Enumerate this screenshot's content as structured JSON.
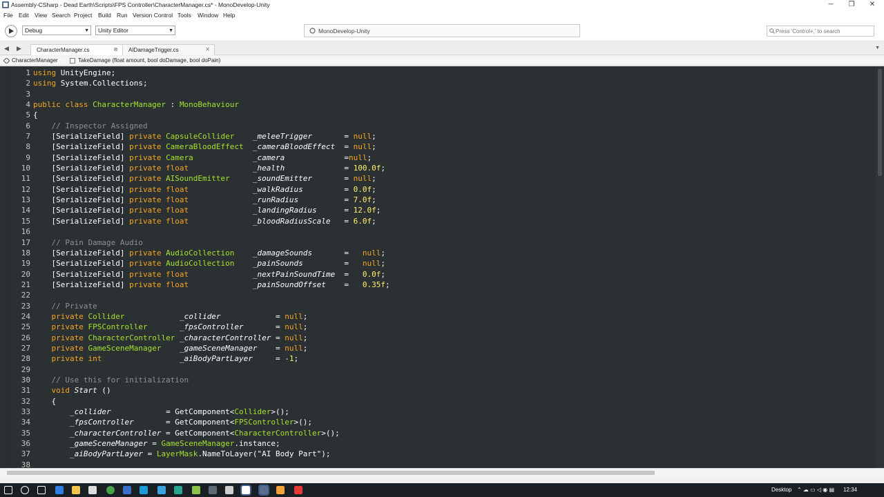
{
  "window": {
    "title": "Assembly-CSharp - Dead Earth\\Scripts\\FPS Controller\\CharacterManager.cs* - MonoDevelop-Unity",
    "minimize": "─",
    "maximize": "❐",
    "close": "✕"
  },
  "menu": [
    "File",
    "Edit",
    "View",
    "Search",
    "Project",
    "Build",
    "Run",
    "Version Control",
    "Tools",
    "Window",
    "Help"
  ],
  "toolbar": {
    "configuration": "Debug",
    "target": "Unity Editor",
    "status": "MonoDevelop-Unity",
    "search_placeholder": "Press 'Control+,' to search"
  },
  "tabs": [
    {
      "label": "CharacterManager.cs",
      "close": "⊗"
    },
    {
      "label": "AIDamageTrigger.cs",
      "close": "✕"
    }
  ],
  "path": {
    "class": "CharacterManager",
    "member": "TakeDamage (float amount, bool doDamage, bool doPain)"
  },
  "colors": {
    "editor_background": "#2b3032",
    "keyword": "#f6a623",
    "type": "#a6e22e",
    "identifier": "#ffffff",
    "comment": "#8a9299",
    "number": "#fff36b",
    "string": "#ffffff"
  },
  "code_lines": [
    {
      "n": "1",
      "tokens": [
        [
          "k",
          "using"
        ],
        [
          "p",
          " UnityEngine;"
        ]
      ]
    },
    {
      "n": "2",
      "tokens": [
        [
          "k",
          "using"
        ],
        [
          "p",
          " System.Collections;"
        ]
      ]
    },
    {
      "n": "3",
      "tokens": []
    },
    {
      "n": "4",
      "tokens": [
        [
          "k",
          "public class "
        ],
        [
          "t",
          "CharacterManager"
        ],
        [
          "p",
          " : "
        ],
        [
          "t",
          "MonoBehaviour"
        ]
      ]
    },
    {
      "n": "5",
      "tokens": [
        [
          "p",
          "{"
        ]
      ]
    },
    {
      "n": "6",
      "tokens": [
        [
          "c",
          "    // Inspector Assigned"
        ]
      ]
    },
    {
      "n": "7",
      "tokens": [
        [
          "p",
          "    [SerializeField] "
        ],
        [
          "k",
          "private "
        ],
        [
          "t",
          "CapsuleCollider"
        ],
        [
          "p",
          "    "
        ],
        [
          "i",
          "_meleeTrigger"
        ],
        [
          "p",
          "       = "
        ],
        [
          "k",
          "null"
        ],
        [
          "p",
          ";"
        ]
      ]
    },
    {
      "n": "8",
      "tokens": [
        [
          "p",
          "    [SerializeField] "
        ],
        [
          "k",
          "private "
        ],
        [
          "t",
          "CameraBloodEffect"
        ],
        [
          "p",
          "  "
        ],
        [
          "i",
          "_cameraBloodEffect"
        ],
        [
          "p",
          "  = "
        ],
        [
          "k",
          "null"
        ],
        [
          "p",
          ";"
        ]
      ]
    },
    {
      "n": "9",
      "tokens": [
        [
          "p",
          "    [SerializeField] "
        ],
        [
          "k",
          "private "
        ],
        [
          "t",
          "Camera"
        ],
        [
          "p",
          "             "
        ],
        [
          "i",
          "_camera"
        ],
        [
          "p",
          "             ="
        ],
        [
          "k",
          "null"
        ],
        [
          "p",
          ";"
        ]
      ]
    },
    {
      "n": "10",
      "tokens": [
        [
          "p",
          "    [SerializeField] "
        ],
        [
          "k",
          "private float"
        ],
        [
          "p",
          "              "
        ],
        [
          "i",
          "_health"
        ],
        [
          "p",
          "             = "
        ],
        [
          "n",
          "100.0f"
        ],
        [
          "p",
          ";"
        ]
      ]
    },
    {
      "n": "11",
      "tokens": [
        [
          "p",
          "    [SerializeField] "
        ],
        [
          "k",
          "private "
        ],
        [
          "t",
          "AISoundEmitter"
        ],
        [
          "p",
          "     "
        ],
        [
          "i",
          "_soundEmitter"
        ],
        [
          "p",
          "       = "
        ],
        [
          "k",
          "null"
        ],
        [
          "p",
          ";"
        ]
      ]
    },
    {
      "n": "12",
      "tokens": [
        [
          "p",
          "    [SerializeField] "
        ],
        [
          "k",
          "private float"
        ],
        [
          "p",
          "              "
        ],
        [
          "i",
          "_walkRadius"
        ],
        [
          "p",
          "         = "
        ],
        [
          "n",
          "0.0f"
        ],
        [
          "p",
          ";"
        ]
      ]
    },
    {
      "n": "13",
      "tokens": [
        [
          "p",
          "    [SerializeField] "
        ],
        [
          "k",
          "private float"
        ],
        [
          "p",
          "              "
        ],
        [
          "i",
          "_runRadius"
        ],
        [
          "p",
          "          = "
        ],
        [
          "n",
          "7.0f"
        ],
        [
          "p",
          ";"
        ]
      ]
    },
    {
      "n": "14",
      "tokens": [
        [
          "p",
          "    [SerializeField] "
        ],
        [
          "k",
          "private float"
        ],
        [
          "p",
          "              "
        ],
        [
          "i",
          "_landingRadius"
        ],
        [
          "p",
          "      = "
        ],
        [
          "n",
          "12.0f"
        ],
        [
          "p",
          ";"
        ]
      ]
    },
    {
      "n": "15",
      "tokens": [
        [
          "p",
          "    [SerializeField] "
        ],
        [
          "k",
          "private float"
        ],
        [
          "p",
          "              "
        ],
        [
          "i",
          "_bloodRadiusScale"
        ],
        [
          "p",
          "   = "
        ],
        [
          "n",
          "6.0f"
        ],
        [
          "p",
          ";"
        ]
      ]
    },
    {
      "n": "16",
      "tokens": []
    },
    {
      "n": "17",
      "tokens": [
        [
          "c",
          "    // Pain Damage Audio"
        ]
      ]
    },
    {
      "n": "18",
      "tokens": [
        [
          "p",
          "    [SerializeField] "
        ],
        [
          "k",
          "private "
        ],
        [
          "t",
          "AudioCollection"
        ],
        [
          "p",
          "    "
        ],
        [
          "i",
          "_damageSounds"
        ],
        [
          "p",
          "       =   "
        ],
        [
          "k",
          "null"
        ],
        [
          "p",
          ";"
        ]
      ]
    },
    {
      "n": "19",
      "tokens": [
        [
          "p",
          "    [SerializeField] "
        ],
        [
          "k",
          "private "
        ],
        [
          "t",
          "AudioCollection"
        ],
        [
          "p",
          "    "
        ],
        [
          "i",
          "_painSounds"
        ],
        [
          "p",
          "         =   "
        ],
        [
          "k",
          "null"
        ],
        [
          "p",
          ";"
        ]
      ]
    },
    {
      "n": "20",
      "tokens": [
        [
          "p",
          "    [SerializeField] "
        ],
        [
          "k",
          "private float"
        ],
        [
          "p",
          "              "
        ],
        [
          "i",
          "_nextPainSoundTime"
        ],
        [
          "p",
          "  =   "
        ],
        [
          "n",
          "0.0f"
        ],
        [
          "p",
          ";"
        ]
      ]
    },
    {
      "n": "21",
      "tokens": [
        [
          "p",
          "    [SerializeField] "
        ],
        [
          "k",
          "private float"
        ],
        [
          "p",
          "              "
        ],
        [
          "i",
          "_painSoundOffset"
        ],
        [
          "p",
          "    =   "
        ],
        [
          "n",
          "0.35f"
        ],
        [
          "p",
          ";"
        ]
      ]
    },
    {
      "n": "22",
      "tokens": []
    },
    {
      "n": "23",
      "tokens": [
        [
          "c",
          "    // Private"
        ]
      ]
    },
    {
      "n": "24",
      "tokens": [
        [
          "k",
          "    private "
        ],
        [
          "t",
          "Collider"
        ],
        [
          "p",
          "            "
        ],
        [
          "i",
          "_collider"
        ],
        [
          "p",
          "            = "
        ],
        [
          "k",
          "null"
        ],
        [
          "p",
          ";"
        ]
      ]
    },
    {
      "n": "25",
      "tokens": [
        [
          "k",
          "    private "
        ],
        [
          "t",
          "FPSController"
        ],
        [
          "p",
          "       "
        ],
        [
          "i",
          "_fpsController"
        ],
        [
          "p",
          "       = "
        ],
        [
          "k",
          "null"
        ],
        [
          "p",
          ";"
        ]
      ]
    },
    {
      "n": "26",
      "tokens": [
        [
          "k",
          "    private "
        ],
        [
          "t",
          "CharacterController"
        ],
        [
          "p",
          " "
        ],
        [
          "i",
          "_characterController"
        ],
        [
          "p",
          " = "
        ],
        [
          "k",
          "null"
        ],
        [
          "p",
          ";"
        ]
      ]
    },
    {
      "n": "27",
      "tokens": [
        [
          "k",
          "    private "
        ],
        [
          "t",
          "GameSceneManager"
        ],
        [
          "p",
          "    "
        ],
        [
          "i",
          "_gameSceneManager"
        ],
        [
          "p",
          "    = "
        ],
        [
          "k",
          "null"
        ],
        [
          "p",
          ";"
        ]
      ]
    },
    {
      "n": "28",
      "tokens": [
        [
          "k",
          "    private int"
        ],
        [
          "p",
          "                 "
        ],
        [
          "i",
          "_aiBodyPartLayer"
        ],
        [
          "p",
          "     = "
        ],
        [
          "n",
          "-1"
        ],
        [
          "p",
          ";"
        ]
      ]
    },
    {
      "n": "29",
      "tokens": []
    },
    {
      "n": "30",
      "tokens": [
        [
          "c",
          "    // Use this for initialization"
        ]
      ]
    },
    {
      "n": "31",
      "tokens": [
        [
          "k",
          "    void "
        ],
        [
          "i",
          "Start"
        ],
        [
          "p",
          " ()"
        ]
      ]
    },
    {
      "n": "32",
      "tokens": [
        [
          "p",
          "    {"
        ]
      ]
    },
    {
      "n": "33",
      "tokens": [
        [
          "i",
          "        _collider"
        ],
        [
          "p",
          "            = GetComponent<"
        ],
        [
          "t",
          "Collider"
        ],
        [
          "p",
          ">();"
        ]
      ]
    },
    {
      "n": "34",
      "tokens": [
        [
          "i",
          "        _fpsController"
        ],
        [
          "p",
          "       = GetComponent<"
        ],
        [
          "t",
          "FPSController"
        ],
        [
          "p",
          ">();"
        ]
      ]
    },
    {
      "n": "35",
      "tokens": [
        [
          "i",
          "        _characterController"
        ],
        [
          "p",
          " = GetComponent<"
        ],
        [
          "t",
          "CharacterController"
        ],
        [
          "p",
          ">();"
        ]
      ]
    },
    {
      "n": "36",
      "tokens": [
        [
          "i",
          "        _gameSceneManager"
        ],
        [
          "p",
          " = "
        ],
        [
          "t",
          "GameSceneManager"
        ],
        [
          "p",
          ".instance;"
        ]
      ]
    },
    {
      "n": "37",
      "tokens": [
        [
          "i",
          "        _aiBodyPartLayer"
        ],
        [
          "p",
          " = "
        ],
        [
          "t",
          "LayerMask"
        ],
        [
          "p",
          ".NameToLayer("
        ],
        [
          "s",
          "\"AI Body Part\""
        ],
        [
          "p",
          ");"
        ]
      ]
    },
    {
      "n": "38",
      "tokens": []
    }
  ],
  "taskbar": {
    "icons": [
      "windows-start-icon",
      "search-icon",
      "task-view-icon",
      "edge-icon",
      "file-explorer-icon",
      "store-icon",
      "chrome-icon",
      "app-icon",
      "app-icon",
      "app-icon",
      "app-icon",
      "app-icon",
      "app-icon",
      "app-icon",
      "unity-icon",
      "monodevelop-icon",
      "app-icon",
      "app-icon"
    ],
    "desktop_label": "Desktop",
    "time": "12:34"
  }
}
